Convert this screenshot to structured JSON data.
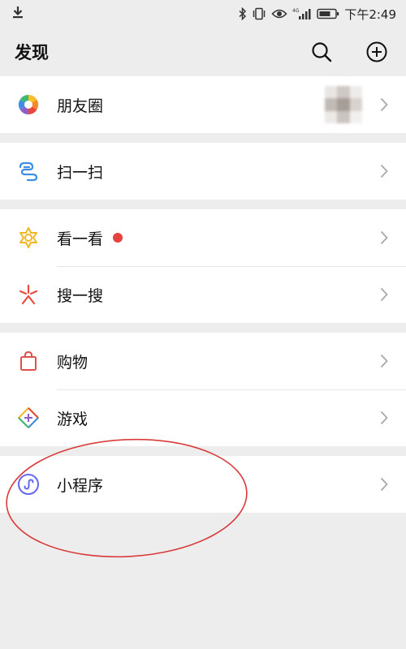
{
  "status_bar": {
    "time": "下午2:49",
    "icons": [
      "download-icon",
      "bluetooth-icon",
      "vibrate-icon",
      "eye-icon",
      "signal-4g-icon",
      "battery-icon"
    ]
  },
  "header": {
    "title": "发现",
    "icons": [
      "search-icon",
      "add-circle-icon"
    ]
  },
  "groups": [
    {
      "items": [
        {
          "label": "朋友圈",
          "icon": "moments-icon",
          "has_avatar": true
        }
      ]
    },
    {
      "items": [
        {
          "label": "扫一扫",
          "icon": "scan-icon"
        }
      ]
    },
    {
      "items": [
        {
          "label": "看一看",
          "icon": "top-stories-icon",
          "badge": true
        },
        {
          "label": "搜一搜",
          "icon": "search-feature-icon"
        }
      ]
    },
    {
      "items": [
        {
          "label": "购物",
          "icon": "shopping-bag-icon"
        },
        {
          "label": "游戏",
          "icon": "games-icon"
        }
      ]
    },
    {
      "items": [
        {
          "label": "小程序",
          "icon": "mini-programs-icon"
        }
      ]
    }
  ],
  "colors": {
    "background": "#ededed",
    "badge": "#e64340",
    "annotation": "#d93a3a",
    "mini_program": "#6467f0",
    "shopping": "#e2504d",
    "top_stories": "#f1b625",
    "scan": "#3c8fe1",
    "search_feature": "#e84c3d"
  }
}
